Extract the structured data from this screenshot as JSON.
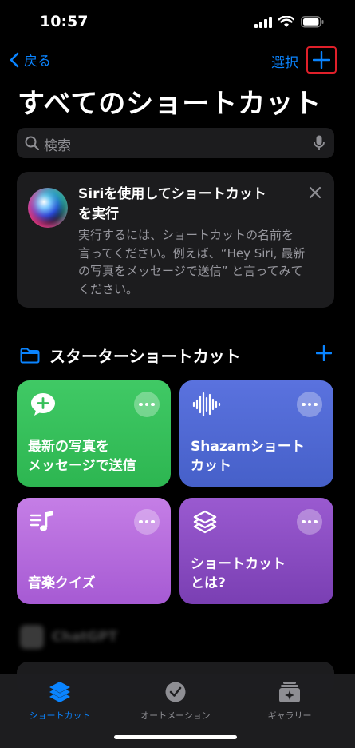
{
  "status": {
    "time": "10:57"
  },
  "nav": {
    "back_label": "戻る",
    "select_label": "選択"
  },
  "title": "すべてのショートカット",
  "search": {
    "placeholder": "検索"
  },
  "siri": {
    "title_line1": "Siriを使用してショートカット",
    "title_line2": "を実行",
    "body_line1": "実行するには、ショートカットの名前を",
    "body_line2": "言ってください。例えば、“Hey Siri, 最新",
    "body_line3": "の写真をメッセージで送信” と言ってみて",
    "body_line4": "ください。"
  },
  "starter": {
    "header": "スターターショートカット",
    "tiles": [
      {
        "line1": "最新の写真を",
        "line2": "メッセージで送信",
        "icon": "message-plus-icon"
      },
      {
        "line1": "Shazamショート",
        "line2": "カット",
        "icon": "waveform-icon"
      },
      {
        "line1": "音楽クイズ",
        "line2": "",
        "icon": "music-list-icon"
      },
      {
        "line1": "ショートカット",
        "line2": "とは?",
        "icon": "shortcuts-layers-icon"
      }
    ]
  },
  "blurred": {
    "label": "ChatGPT"
  },
  "tabs": [
    {
      "label": "ショートカット",
      "icon": "layers-icon"
    },
    {
      "label": "オートメーション",
      "icon": "clock-check-icon"
    },
    {
      "label": "ギャラリー",
      "icon": "gallery-icon"
    }
  ],
  "colors": {
    "accent": "#0a84ff",
    "highlight_box": "#e0202a"
  }
}
